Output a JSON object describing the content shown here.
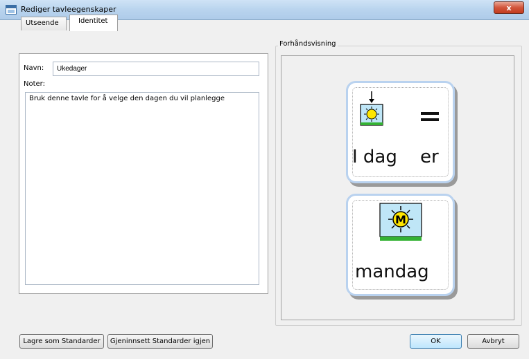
{
  "window": {
    "title": "Rediger tavleegenskaper",
    "close_symbol": "x"
  },
  "tabs": [
    {
      "label": "Utseende",
      "active": false
    },
    {
      "label": "Identitet",
      "active": true
    }
  ],
  "form": {
    "name_label": "Navn:",
    "name_value": "Ukedager",
    "notes_label": "Noter:",
    "notes_value": "Bruk denne tavle for å velge den dagen du vil planlegge"
  },
  "preview": {
    "label": "Forhåndsvisning",
    "cards": [
      {
        "words": [
          "I dag",
          "er"
        ],
        "symbols": [
          "today-sun-symbol",
          "equals-symbol"
        ]
      },
      {
        "words": [
          "mandag"
        ],
        "symbols": [
          "monday-sun-symbol"
        ],
        "symbol_letter": "M"
      }
    ]
  },
  "buttons": {
    "save_defaults": "Lagre som Standarder",
    "restore_defaults": "Gjeninnsett Standarder igjen",
    "ok": "OK",
    "cancel": "Avbryt"
  }
}
